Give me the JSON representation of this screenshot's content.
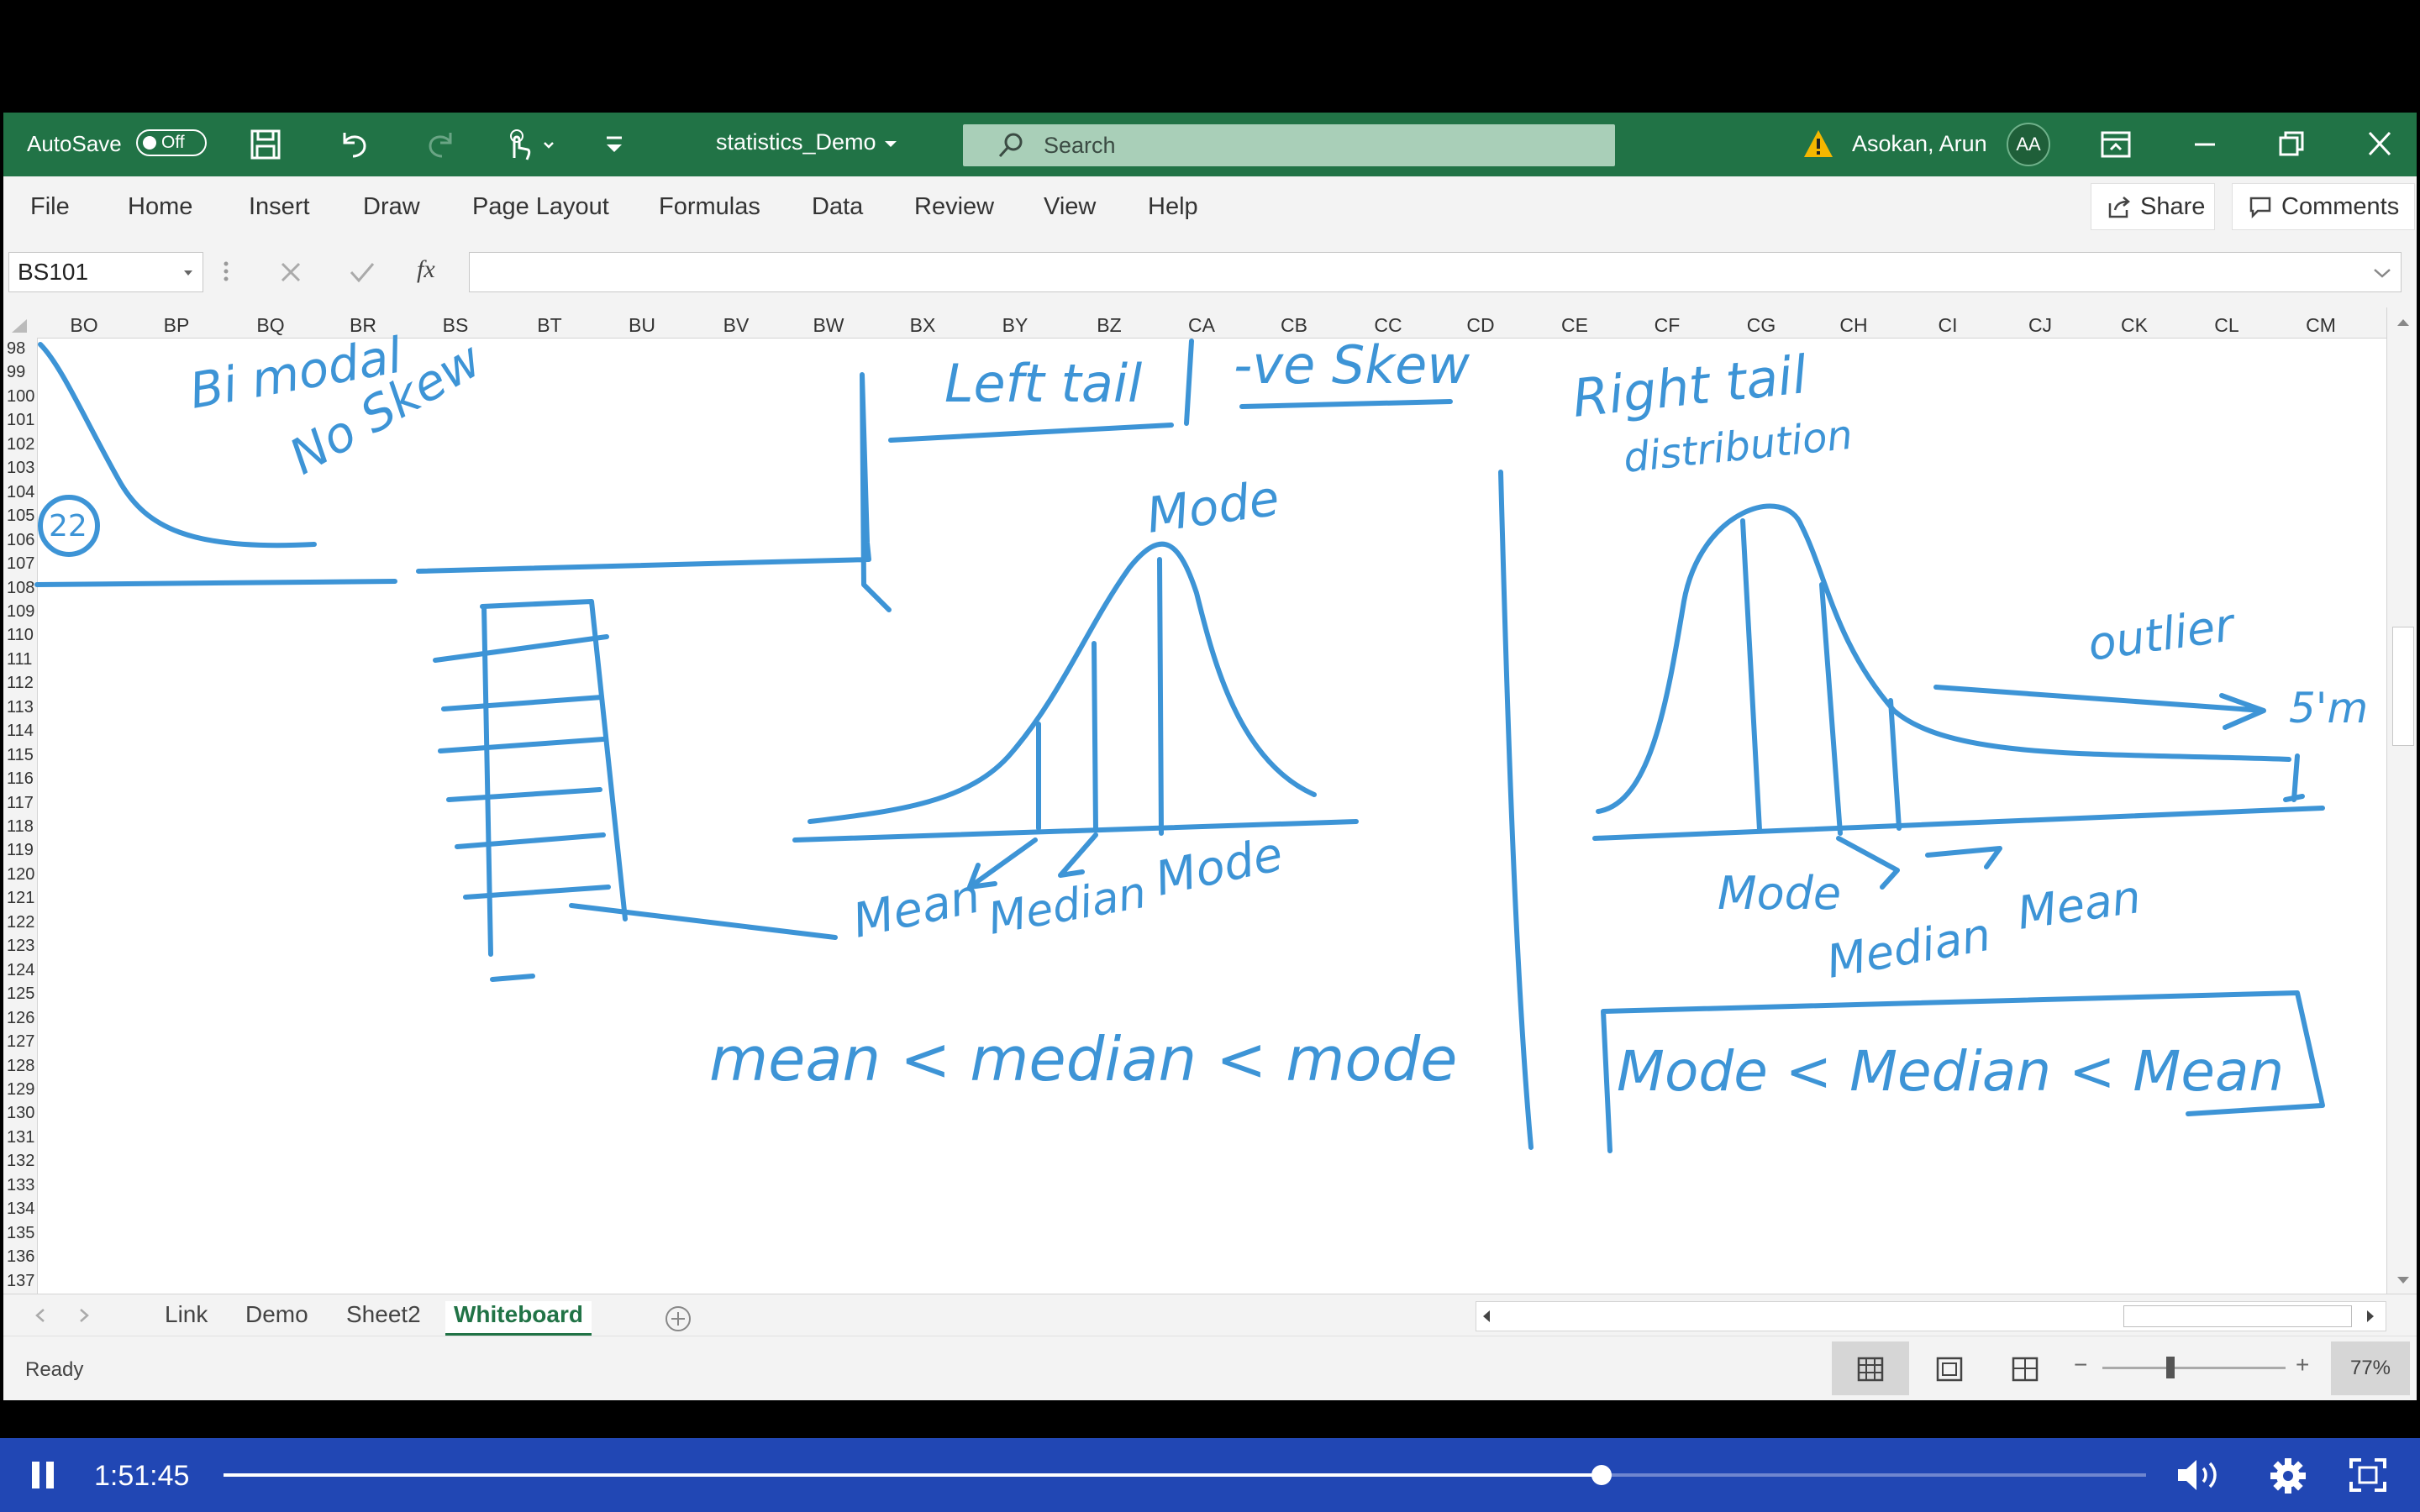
{
  "title_bar": {
    "autosave_label": "AutoSave",
    "autosave_state": "Off",
    "file_name": "statistics_Demo",
    "search_placeholder": "Search",
    "user_name": "Asokan, Arun",
    "user_initials": "AA"
  },
  "ribbon": {
    "menu": [
      "File",
      "Home",
      "Insert",
      "Draw",
      "Page Layout",
      "Formulas",
      "Data",
      "Review",
      "View",
      "Help"
    ],
    "share_label": "Share",
    "comments_label": "Comments"
  },
  "formula_bar": {
    "name_box": "BS101",
    "fx_label": "fx",
    "formula": ""
  },
  "columns": [
    "BO",
    "BP",
    "BQ",
    "BR",
    "BS",
    "BT",
    "BU",
    "BV",
    "BW",
    "BX",
    "BY",
    "BZ",
    "CA",
    "CB",
    "CC",
    "CD",
    "CE",
    "CF",
    "CG",
    "CH",
    "CI",
    "CJ",
    "CK",
    "CL",
    "CM"
  ],
  "rows": [
    "98",
    "99",
    "100",
    "101",
    "102",
    "103",
    "104",
    "105",
    "106",
    "107",
    "108",
    "109",
    "110",
    "111",
    "112",
    "113",
    "114",
    "115",
    "116",
    "117",
    "118",
    "119",
    "120",
    "121",
    "122",
    "123",
    "124",
    "125",
    "126",
    "127",
    "128",
    "129",
    "130",
    "131",
    "132",
    "133",
    "134",
    "135",
    "136",
    "137"
  ],
  "whiteboard": {
    "labels": {
      "bimodal": "Bi modal",
      "no_skew": "No Skew",
      "circled": "22",
      "left_tail": "Left tail",
      "neg_skew": "-ve Skew",
      "right_tail": "Right tail",
      "distribution": "distribution",
      "mode_top": "Mode",
      "mean_left": "Mean",
      "median_left": "Median",
      "mode_left": "Mode",
      "inequality_left": "mean < median < mode",
      "outlier": "outlier",
      "five_m": "5'm",
      "mode_right": "Mode",
      "median_right": "Median",
      "mean_right": "Mean",
      "inequality_right": "Mode < Median < Mean"
    }
  },
  "sheet_tabs": [
    "Link",
    "Demo",
    "Sheet2",
    "Whiteboard"
  ],
  "active_tab": "Whiteboard",
  "status": {
    "ready": "Ready",
    "zoom": "77%"
  },
  "video": {
    "timestamp": "1:51:45",
    "progress": 0.717
  },
  "colors": {
    "excel_green": "#217346",
    "ink_blue": "#3d94d6",
    "player_blue": "#2147b4"
  }
}
